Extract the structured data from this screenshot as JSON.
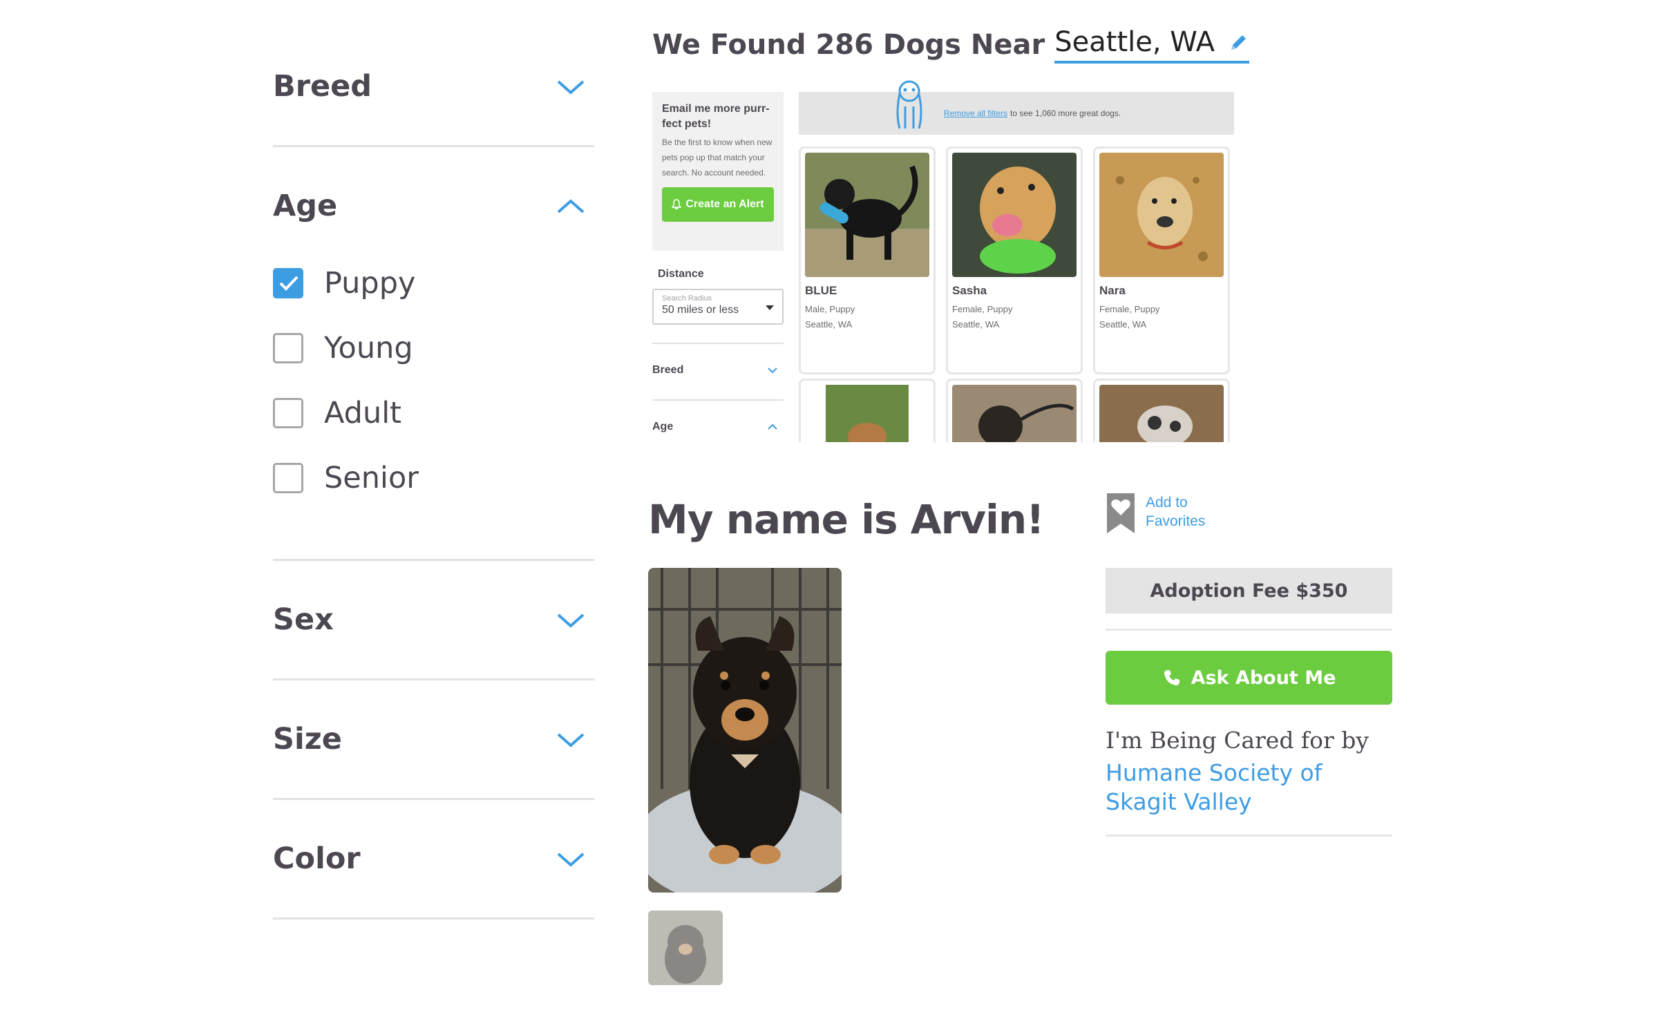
{
  "filters": {
    "sections": [
      {
        "label": "Breed"
      },
      {
        "label": "Age",
        "options": [
          {
            "label": "Puppy",
            "checked": true
          },
          {
            "label": "Young",
            "checked": false
          },
          {
            "label": "Adult",
            "checked": false
          },
          {
            "label": "Senior",
            "checked": false
          }
        ]
      },
      {
        "label": "Sex"
      },
      {
        "label": "Size"
      },
      {
        "label": "Color"
      }
    ]
  },
  "results": {
    "title_prefix": "We Found 286 Dogs Near",
    "location": "Seattle, WA",
    "alert": {
      "heading": "Email me more purr-fect pets!",
      "text": "Be the first to know when new pets pop up that match your search. No account needed.",
      "button": "Create an Alert"
    },
    "distance_label": "Distance",
    "radius_label": "Search Radius",
    "radius_value": "50 miles or less",
    "mini_filters": [
      "Breed",
      "Age"
    ],
    "banner_link": "Remove all filters",
    "banner_text": "to see 1,060 more great dogs.",
    "cards": [
      {
        "name": "BLUE",
        "info1": "Male, Puppy",
        "info2": "Seattle, WA"
      },
      {
        "name": "Sasha",
        "info1": "Female, Puppy",
        "info2": "Seattle, WA"
      },
      {
        "name": "Nara",
        "info1": "Female, Puppy",
        "info2": "Seattle, WA"
      }
    ]
  },
  "pet": {
    "title": "My name is Arvin!",
    "favorite_line1": "Add to",
    "favorite_line2": "Favorites",
    "fee": "Adoption Fee $350",
    "ask_button": "Ask About Me",
    "cared_for": "I'm Being Cared for by",
    "organization": "Humane Society of Skagit Valley"
  },
  "colors": {
    "accent": "#3d9de3",
    "green": "#6ccc3f",
    "text": "#4d4751"
  }
}
